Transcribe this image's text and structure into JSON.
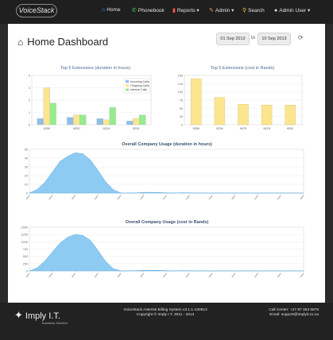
{
  "app": {
    "logo": "VoiceStack"
  },
  "nav": {
    "home": "Home",
    "phonebook": "Phonebook",
    "reports": "Reports",
    "admin": "Admin",
    "search": "Search",
    "admin_user": "Admin User"
  },
  "header": {
    "title": "Home Dashboard",
    "date_from": "01 Sep 2013",
    "date_to_label": "to",
    "date_to": "10 Sep 2013"
  },
  "colors": {
    "incoming": "#8ebfe8",
    "outgoing": "#fbe58f",
    "internal": "#96ec8c",
    "usage": "#8ecbf3"
  },
  "chart_data": [
    {
      "type": "bar",
      "title": "Top 5 Extensions (duration in hours)",
      "categories": [
        "9259",
        "9252",
        "9224",
        "9231"
      ],
      "series": [
        {
          "name": "Incoming Calls",
          "values": [
            0.5,
            0.6,
            0.5,
            0.3
          ]
        },
        {
          "name": "Outgoing Calls",
          "values": [
            3.0,
            0.8,
            0.4,
            0.5
          ]
        },
        {
          "name": "Internal Calls",
          "values": [
            1.75,
            0.8,
            1.4,
            0.8
          ]
        }
      ],
      "ylim": [
        0,
        4
      ],
      "yticks": [
        "0",
        "1",
        "2",
        "3",
        "4"
      ],
      "legend": "top-right"
    },
    {
      "type": "bar",
      "title": "Top 5 Extensions (cost in Rands)",
      "categories": [
        "9259",
        "9234",
        "9479",
        "9478",
        "9251"
      ],
      "values": [
        140,
        83,
        62,
        60,
        60
      ],
      "ylim": [
        0,
        150
      ],
      "yticks": [
        "0",
        "25",
        "50",
        "75",
        "100",
        "125",
        "150"
      ]
    },
    {
      "type": "area",
      "title": "Overall Company Usage (duration in hours)",
      "x": [
        0,
        1,
        2,
        3,
        4,
        5,
        6,
        7,
        8,
        9,
        10,
        11,
        12,
        13,
        14,
        15,
        16,
        17,
        18,
        19,
        20,
        21,
        22,
        23,
        24,
        25,
        26,
        27,
        28,
        29,
        30,
        31,
        32,
        33,
        34,
        35,
        36
      ],
      "values": [
        0,
        4,
        12,
        24,
        36,
        42,
        46,
        45,
        38,
        26,
        13,
        4,
        0,
        0,
        0.3,
        0.6,
        0.8,
        0.6,
        0.3,
        0,
        0.4,
        0.3,
        0,
        0,
        0,
        0,
        0,
        0,
        0,
        0,
        0,
        0,
        0,
        0,
        0,
        0,
        0
      ],
      "ylim": [
        0,
        50
      ],
      "yticks": [
        "0",
        "10",
        "20",
        "30",
        "40",
        "50"
      ]
    },
    {
      "type": "area",
      "title": "Overall Company Usage (cost in Rands)",
      "x": [
        0,
        1,
        2,
        3,
        4,
        5,
        6,
        7,
        8,
        9,
        10,
        11,
        12,
        13,
        14,
        15,
        16,
        17,
        18,
        19,
        20,
        21,
        22,
        23,
        24,
        25,
        26,
        27,
        28,
        29,
        30,
        31,
        32,
        33,
        34,
        35,
        36
      ],
      "values": [
        0,
        100,
        330,
        650,
        950,
        1150,
        1250,
        1220,
        1050,
        700,
        330,
        80,
        0,
        0,
        10,
        20,
        25,
        20,
        10,
        0,
        12,
        8,
        0,
        0,
        0,
        0,
        0,
        0,
        0,
        0,
        0,
        0,
        0,
        0,
        0,
        0,
        0
      ],
      "ylim": [
        0,
        1500
      ],
      "yticks": [
        "0",
        "250",
        "500",
        "750",
        "1000",
        "1250",
        "1500"
      ]
    }
  ],
  "footer": {
    "brand": "Imply I.T.",
    "brand_sub": "Business Solution",
    "line1": "VoiceStack Asterisk Billing System v3.1.1-130913",
    "line2": "Copyright © Imply I.T. 2011 - 2013",
    "call_center": "Call Center: +27 87 353 6878",
    "email": "Email: support@implyit.co.za"
  }
}
